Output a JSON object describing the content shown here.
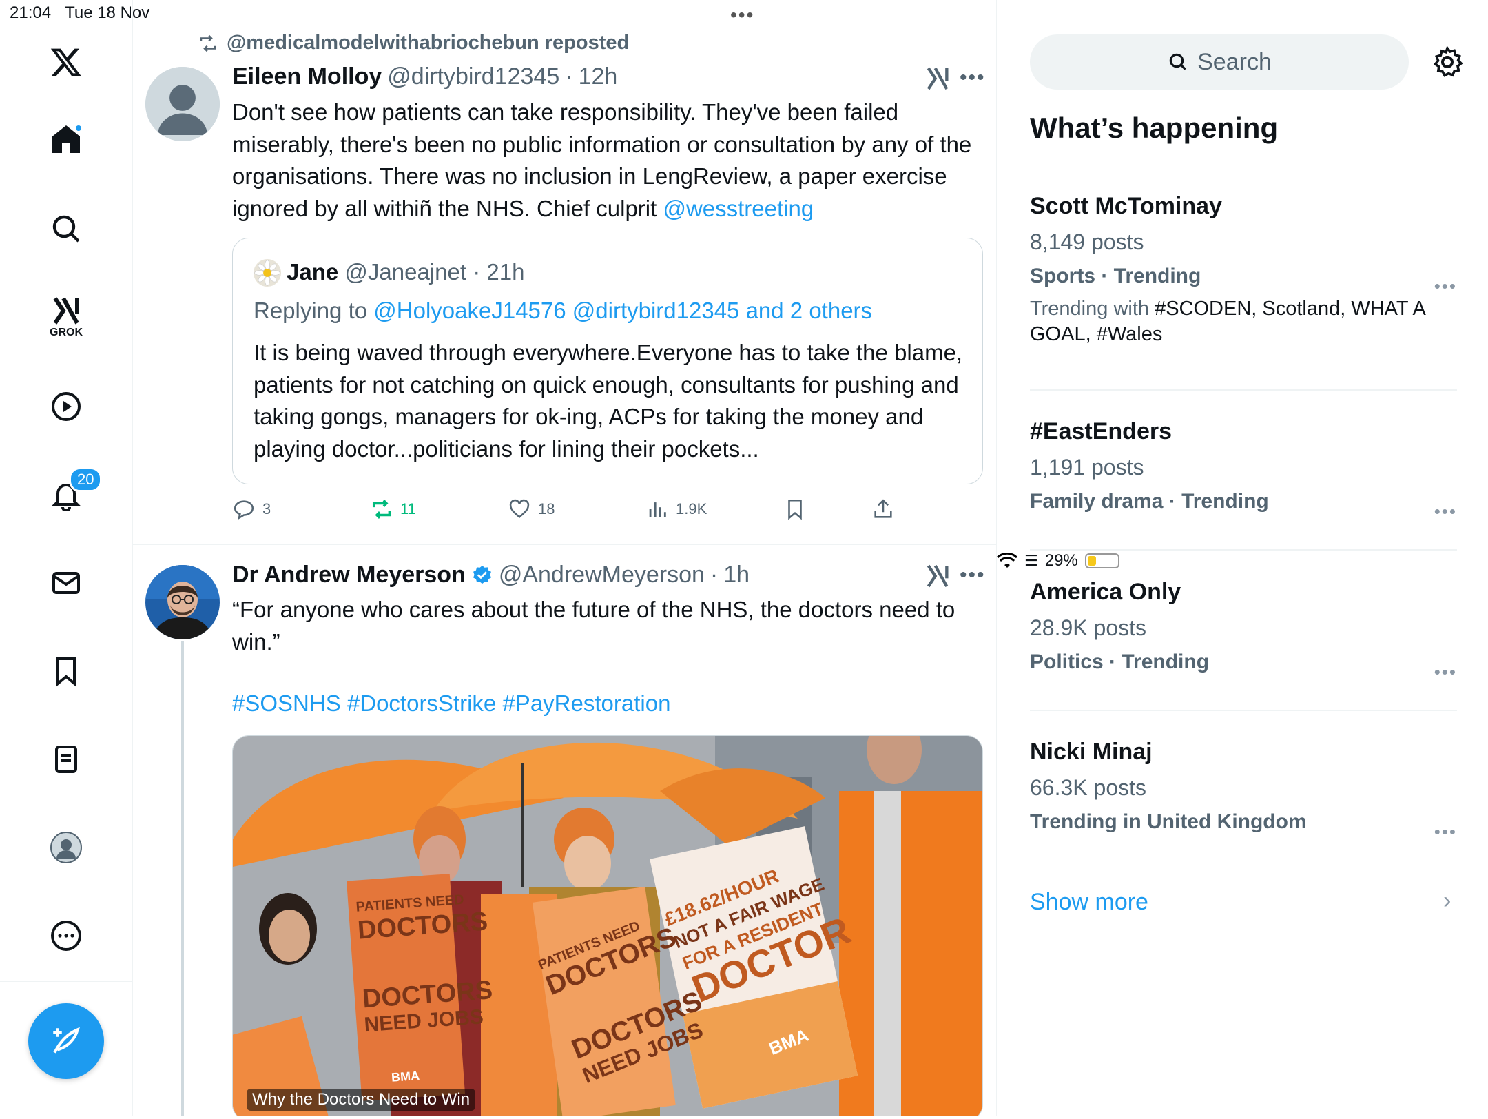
{
  "status_bar": {
    "time": "21:04",
    "date": "Tue 18 Nov",
    "battery": "29%",
    "battery_level": 0.29
  },
  "nav": {
    "notifications_badge": "20",
    "grok_label": "GROK"
  },
  "tweets": [
    {
      "repost_by": "@medicalmodelwithabriochebun reposted",
      "name": "Eileen Molloy",
      "handle": "@dirtybird12345",
      "time": "12h",
      "text_main": "Don't see how patients can take responsibility. They've been failed miserably, there's been no public information or consultation by any of the organisations. There was no inclusion in LengReview, a paper exercise ignored by all withiñ the NHS. Chief culprit ",
      "text_mention": "@wesstreeting",
      "quote": {
        "name": "Jane",
        "handle": "@Janeajnet",
        "time": "21h",
        "replying_prefix": "Replying to ",
        "replying_to": "@HolyoakeJ14576 @dirtybird12345 and 2 others",
        "text": "It is being waved through everywhere.Everyone has to take the blame, patients for not catching on quick enough, consultants for pushing and taking gongs, managers for ok-ing, ACPs for taking the money and playing doctor...politicians for lining their pockets..."
      },
      "replies": "3",
      "reposts": "11",
      "likes": "18",
      "views": "1.9K"
    },
    {
      "name": "Dr Andrew Meyerson",
      "handle": "@AndrewMeyerson",
      "time": "1h",
      "text": "“For anyone who cares about the future of the NHS, the doctors need to win.”",
      "hashtags": "#SOSNHS #DoctorsStrike #PayRestoration",
      "media_caption": "Why the Doctors Need to Win",
      "signs": {
        "sign1_a": "PATIENTS NEED",
        "sign1_b": "DOCTORS",
        "sign1_c": "DOCTORS",
        "sign1_d": "NEED JOBS",
        "sign2": "£18.62/HOUR",
        "sign2_b": "NOT A FAIR WAGE",
        "sign2_c": "FOR A RESIDENT",
        "sign2_d": "DOCTOR",
        "bma": "BMA"
      }
    }
  ],
  "sidebar": {
    "search_placeholder": "Search",
    "heading": "What’s happening",
    "trends": [
      {
        "title": "Scott McTominay",
        "posts": "8,149 posts",
        "category": "Sports · Trending",
        "with_lead": "Trending with ",
        "with_rest": "#SCODEN, Scotland, WHAT A GOAL, #Wales"
      },
      {
        "title": "#EastEnders",
        "posts": "1,191 posts",
        "category": "Family drama · Trending"
      },
      {
        "title": "America Only",
        "posts": "28.9K posts",
        "category": "Politics · Trending"
      },
      {
        "title": "Nicki Minaj",
        "posts": "66.3K posts",
        "category": "Trending in United Kingdom"
      }
    ],
    "show_more": "Show more"
  },
  "colors": {
    "accent": "#1d9bf0",
    "muted": "#536471",
    "repost_green": "#00ba7c",
    "orange": "#f28a2e"
  }
}
